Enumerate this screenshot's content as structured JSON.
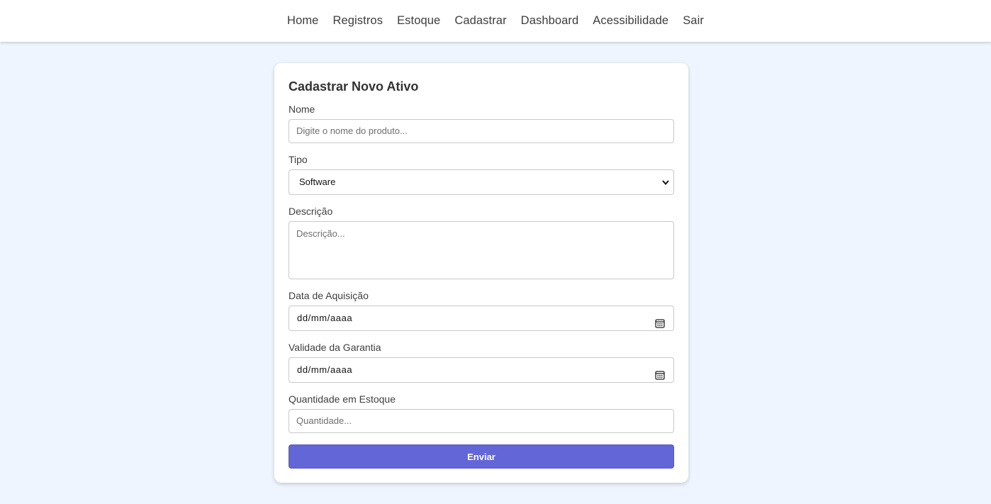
{
  "nav": {
    "items": [
      {
        "label": "Home"
      },
      {
        "label": "Registros"
      },
      {
        "label": "Estoque"
      },
      {
        "label": "Cadastrar"
      },
      {
        "label": "Dashboard"
      },
      {
        "label": "Acessibilidade"
      },
      {
        "label": "Sair"
      }
    ]
  },
  "form": {
    "title": "Cadastrar Novo Ativo",
    "nome": {
      "label": "Nome",
      "placeholder": "Digite o nome do produto..."
    },
    "tipo": {
      "label": "Tipo",
      "selected": "Software"
    },
    "descricao": {
      "label": "Descrição",
      "placeholder": "Descrição..."
    },
    "aquisicao": {
      "label": "Data de Aquisição",
      "value": "dd/mm/aaaa"
    },
    "garantia": {
      "label": "Validade da Garantia",
      "value": "dd/mm/aaaa"
    },
    "quantidade": {
      "label": "Quantidade em Estoque",
      "placeholder": "Quantidade..."
    },
    "submit_label": "Enviar"
  },
  "colors": {
    "page_background": "#eef5ff",
    "accent": "#6366d6"
  },
  "icons": {
    "date_picker": "calendar-icon",
    "select": "chevron-down-icon"
  }
}
